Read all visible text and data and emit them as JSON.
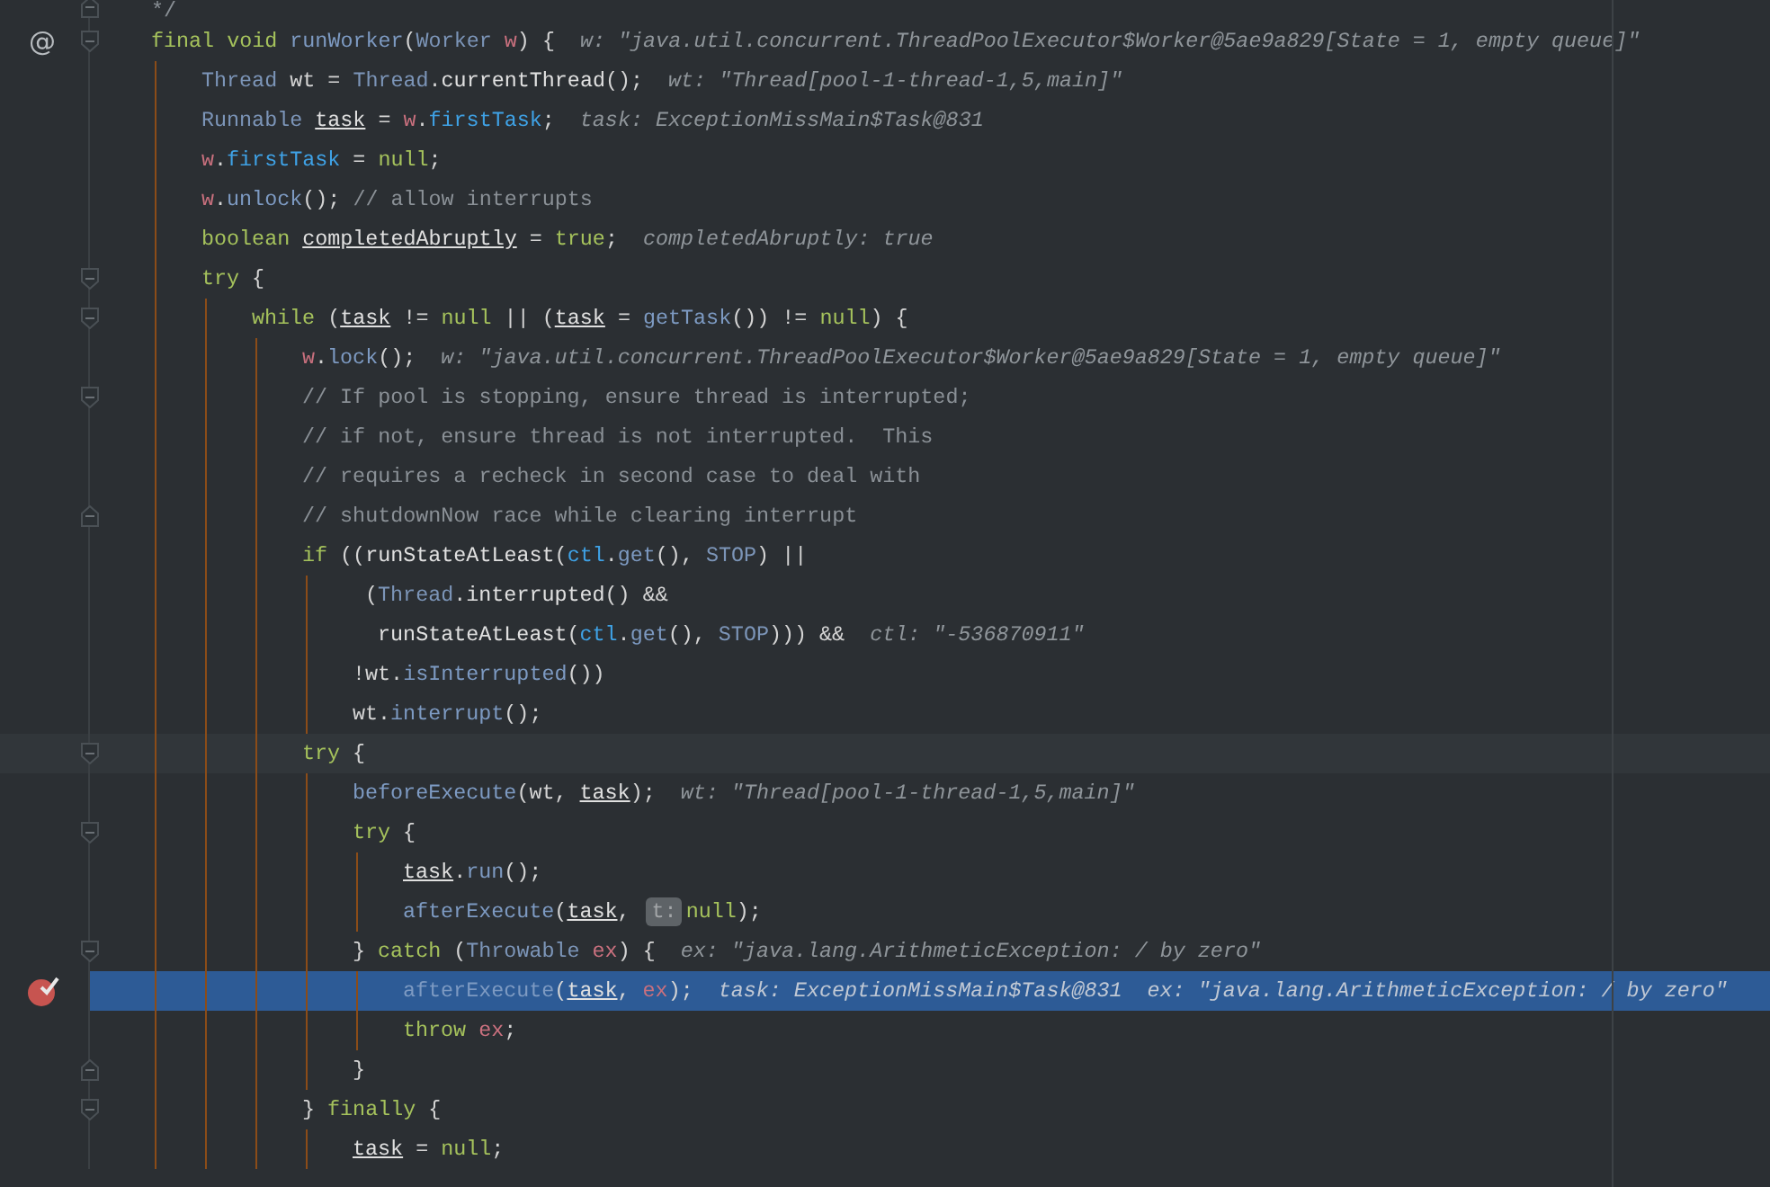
{
  "editor": {
    "lines": [
      {
        "fold_end": true,
        "tokens": [
          {
            "text": "*/",
            "kind": "comment"
          }
        ]
      },
      {
        "gutter_mark": "@",
        "fold_start": true,
        "tokens": [
          {
            "text": "final void ",
            "kind": "kw"
          },
          {
            "text": "runWorker",
            "kind": "fn"
          },
          {
            "text": "(",
            "kind": "op"
          },
          {
            "text": "Worker ",
            "kind": "type"
          },
          {
            "text": "w",
            "kind": "param"
          },
          {
            "text": ") {",
            "kind": "op"
          },
          {
            "text": "w: \"java.util.concurrent.ThreadPoolExecutor$Worker@5ae9a829[State = 1, empty queue]\"",
            "kind": "hint"
          }
        ],
        "children": [
          {
            "tokens": [
              {
                "text": "Thread",
                "kind": "type"
              },
              {
                "text": " wt = ",
                "kind": "op"
              },
              {
                "text": "Thread",
                "kind": "type"
              },
              {
                "text": ".",
                "kind": "op"
              },
              {
                "text": "currentThread",
                "kind": "sfn"
              },
              {
                "text": "();",
                "kind": "op"
              },
              {
                "text": "wt: \"Thread[pool-1-thread-1,5,main]\"",
                "kind": "hint"
              }
            ]
          },
          {
            "tokens": [
              {
                "text": "Runnable ",
                "kind": "type"
              },
              {
                "text": "task",
                "kind": "var"
              },
              {
                "text": " = ",
                "kind": "op"
              },
              {
                "text": "w",
                "kind": "param"
              },
              {
                "text": ".",
                "kind": "op"
              },
              {
                "text": "firstTask",
                "kind": "field"
              },
              {
                "text": ";",
                "kind": "op"
              },
              {
                "text": "task: ExceptionMissMain$Task@831",
                "kind": "hint"
              }
            ]
          },
          {
            "tokens": [
              {
                "text": "w",
                "kind": "param"
              },
              {
                "text": ".",
                "kind": "op"
              },
              {
                "text": "firstTask",
                "kind": "field"
              },
              {
                "text": " = ",
                "kind": "op"
              },
              {
                "text": "null",
                "kind": "kw"
              },
              {
                "text": ";",
                "kind": "op"
              }
            ]
          },
          {
            "tokens": [
              {
                "text": "w",
                "kind": "param"
              },
              {
                "text": ".",
                "kind": "op"
              },
              {
                "text": "unlock",
                "kind": "fn"
              },
              {
                "text": "(); ",
                "kind": "op"
              },
              {
                "text": "// allow interrupts",
                "kind": "comment"
              }
            ]
          },
          {
            "tokens": [
              {
                "text": "boolean ",
                "kind": "kw"
              },
              {
                "text": "completedAbruptly",
                "kind": "var"
              },
              {
                "text": " = ",
                "kind": "op"
              },
              {
                "text": "true",
                "kind": "kw"
              },
              {
                "text": ";",
                "kind": "op"
              },
              {
                "text": "completedAbruptly: true",
                "kind": "hint"
              }
            ]
          },
          {
            "fold_start": true,
            "tokens": [
              {
                "text": "try",
                "kind": "kw"
              },
              {
                "text": " {",
                "kind": "op"
              }
            ],
            "children": [
              {
                "fold_start": true,
                "tokens": [
                  {
                    "text": "while",
                    "kind": "kw"
                  },
                  {
                    "text": " (",
                    "kind": "op"
                  },
                  {
                    "text": "task",
                    "kind": "var"
                  },
                  {
                    "text": " != ",
                    "kind": "op"
                  },
                  {
                    "text": "null",
                    "kind": "kw"
                  },
                  {
                    "text": " || (",
                    "kind": "op"
                  },
                  {
                    "text": "task",
                    "kind": "var"
                  },
                  {
                    "text": " = ",
                    "kind": "op"
                  },
                  {
                    "text": "getTask",
                    "kind": "fn"
                  },
                  {
                    "text": "()) != ",
                    "kind": "op"
                  },
                  {
                    "text": "null",
                    "kind": "kw"
                  },
                  {
                    "text": ") {",
                    "kind": "op"
                  }
                ],
                "children": [
                  {
                    "tokens": [
                      {
                        "text": "w",
                        "kind": "param"
                      },
                      {
                        "text": ".",
                        "kind": "op"
                      },
                      {
                        "text": "lock",
                        "kind": "fn"
                      },
                      {
                        "text": "();",
                        "kind": "op"
                      },
                      {
                        "text": "w: \"java.util.concurrent.ThreadPoolExecutor$Worker@5ae9a829[State = 1, empty queue]\"",
                        "kind": "hint"
                      }
                    ]
                  },
                  {
                    "fold_start": true,
                    "tokens": [
                      {
                        "text": "// If pool is stopping, ensure thread is interrupted;",
                        "kind": "comment"
                      }
                    ]
                  },
                  {
                    "tokens": [
                      {
                        "text": "// if not, ensure thread is not interrupted.  This",
                        "kind": "comment"
                      }
                    ]
                  },
                  {
                    "tokens": [
                      {
                        "text": "// requires a recheck in second case to deal with",
                        "kind": "comment"
                      }
                    ]
                  },
                  {
                    "fold_end": true,
                    "tokens": [
                      {
                        "text": "// shutdownNow race while clearing interrupt",
                        "kind": "comment"
                      }
                    ]
                  },
                  {
                    "tokens": [
                      {
                        "text": "if",
                        "kind": "kw"
                      },
                      {
                        "text": " ((",
                        "kind": "op"
                      },
                      {
                        "text": "runStateAtLeast",
                        "kind": "sfn"
                      },
                      {
                        "text": "(",
                        "kind": "op"
                      },
                      {
                        "text": "ctl",
                        "kind": "field"
                      },
                      {
                        "text": ".",
                        "kind": "op"
                      },
                      {
                        "text": "get",
                        "kind": "fn"
                      },
                      {
                        "text": "(), ",
                        "kind": "op"
                      },
                      {
                        "text": "STOP",
                        "kind": "const"
                      },
                      {
                        "text": ") ||",
                        "kind": "op"
                      }
                    ],
                    "children": [
                      {
                        "tokens": [
                          {
                            "text": " (",
                            "kind": "op"
                          },
                          {
                            "text": "Thread",
                            "kind": "type"
                          },
                          {
                            "text": ".",
                            "kind": "op"
                          },
                          {
                            "text": "interrupted",
                            "kind": "sfn"
                          },
                          {
                            "text": "() &&",
                            "kind": "op"
                          }
                        ]
                      },
                      {
                        "tokens": [
                          {
                            "text": "  runStateAtLeast",
                            "kind": "sfn"
                          },
                          {
                            "text": "(",
                            "kind": "op"
                          },
                          {
                            "text": "ctl",
                            "kind": "field"
                          },
                          {
                            "text": ".",
                            "kind": "op"
                          },
                          {
                            "text": "get",
                            "kind": "fn"
                          },
                          {
                            "text": "(), ",
                            "kind": "op"
                          },
                          {
                            "text": "STOP",
                            "kind": "const"
                          },
                          {
                            "text": "))) &&",
                            "kind": "op"
                          },
                          {
                            "text": "ctl: \"-536870911\"",
                            "kind": "hint"
                          }
                        ]
                      },
                      {
                        "tokens": [
                          {
                            "text": "!wt.",
                            "kind": "op"
                          },
                          {
                            "text": "isInterrupted",
                            "kind": "fn"
                          },
                          {
                            "text": "())",
                            "kind": "op"
                          }
                        ]
                      },
                      {
                        "tokens": [
                          {
                            "text": "wt.",
                            "kind": "op"
                          },
                          {
                            "text": "interrupt",
                            "kind": "fn"
                          },
                          {
                            "text": "();",
                            "kind": "op"
                          }
                        ]
                      }
                    ]
                  },
                  {
                    "caret": true,
                    "fold_start": true,
                    "tokens": [
                      {
                        "text": "try",
                        "kind": "kw"
                      },
                      {
                        "text": " {",
                        "kind": "op"
                      }
                    ],
                    "children": [
                      {
                        "tokens": [
                          {
                            "text": "beforeExecute",
                            "kind": "fn"
                          },
                          {
                            "text": "(wt, ",
                            "kind": "op"
                          },
                          {
                            "text": "task",
                            "kind": "var"
                          },
                          {
                            "text": ");",
                            "kind": "op"
                          },
                          {
                            "text": "wt: \"Thread[pool-1-thread-1,5,main]\"",
                            "kind": "hint"
                          }
                        ]
                      },
                      {
                        "fold_start": true,
                        "tokens": [
                          {
                            "text": "try",
                            "kind": "kw"
                          },
                          {
                            "text": " {",
                            "kind": "op"
                          }
                        ],
                        "children": [
                          {
                            "tokens": [
                              {
                                "text": "task",
                                "kind": "var"
                              },
                              {
                                "text": ".",
                                "kind": "op"
                              },
                              {
                                "text": "run",
                                "kind": "fn"
                              },
                              {
                                "text": "();",
                                "kind": "op"
                              }
                            ]
                          },
                          {
                            "tokens": [
                              {
                                "text": "afterExecute",
                                "kind": "fn"
                              },
                              {
                                "text": "(",
                                "kind": "op"
                              },
                              {
                                "text": "task",
                                "kind": "var"
                              },
                              {
                                "text": ", ",
                                "kind": "op"
                              },
                              {
                                "text": "t:",
                                "kind": "badge"
                              },
                              {
                                "text": "null",
                                "kind": "kw"
                              },
                              {
                                "text": ");",
                                "kind": "op"
                              }
                            ]
                          }
                        ]
                      },
                      {
                        "fold_start": true,
                        "tokens": [
                          {
                            "text": "} ",
                            "kind": "op"
                          },
                          {
                            "text": "catch",
                            "kind": "kw"
                          },
                          {
                            "text": " (",
                            "kind": "op"
                          },
                          {
                            "text": "Throwable ",
                            "kind": "type"
                          },
                          {
                            "text": "ex",
                            "kind": "param"
                          },
                          {
                            "text": ") {",
                            "kind": "op"
                          },
                          {
                            "text": "ex: \"java.lang.ArithmeticException: / by zero\"",
                            "kind": "hint"
                          }
                        ],
                        "children": [
                          {
                            "breakpoint": true,
                            "execution_point": true,
                            "tokens": [
                              {
                                "text": "afterExecute",
                                "kind": "fn"
                              },
                              {
                                "text": "(",
                                "kind": "op"
                              },
                              {
                                "text": "task",
                                "kind": "var"
                              },
                              {
                                "text": ", ",
                                "kind": "op"
                              },
                              {
                                "text": "ex",
                                "kind": "param"
                              },
                              {
                                "text": ");",
                                "kind": "op"
                              },
                              {
                                "text": "task: ExceptionMissMain$Task@831",
                                "kind": "hint"
                              },
                              {
                                "text": "ex: \"java.lang.ArithmeticException: / by zero\"",
                                "kind": "hint"
                              }
                            ]
                          },
                          {
                            "tokens": [
                              {
                                "text": "throw ",
                                "kind": "kw"
                              },
                              {
                                "text": "ex",
                                "kind": "param"
                              },
                              {
                                "text": ";",
                                "kind": "op"
                              }
                            ]
                          }
                        ]
                      },
                      {
                        "fold_end": true,
                        "tokens": [
                          {
                            "text": "}",
                            "kind": "op"
                          }
                        ]
                      }
                    ]
                  },
                  {
                    "fold_start": true,
                    "tokens": [
                      {
                        "text": "} ",
                        "kind": "op"
                      },
                      {
                        "text": "finally",
                        "kind": "kw"
                      },
                      {
                        "text": " {",
                        "kind": "op"
                      }
                    ],
                    "children": [
                      {
                        "tokens": [
                          {
                            "text": "task",
                            "kind": "var"
                          },
                          {
                            "text": " = ",
                            "kind": "op"
                          },
                          {
                            "text": "null",
                            "kind": "kw"
                          },
                          {
                            "text": ";",
                            "kind": "op"
                          }
                        ]
                      }
                    ]
                  }
                ]
              }
            ]
          }
        ]
      }
    ]
  }
}
